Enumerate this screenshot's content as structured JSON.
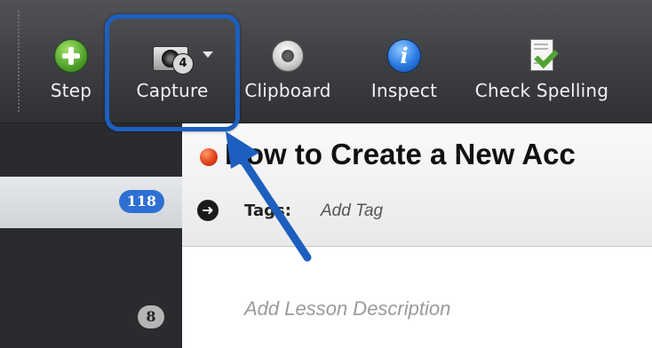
{
  "toolbar": {
    "tools": [
      {
        "label": "Step",
        "icon": "plus-icon"
      },
      {
        "label": "Capture",
        "icon": "camera-icon",
        "badge": "4"
      },
      {
        "label": "Clipboard",
        "icon": "clipboard-icon"
      },
      {
        "label": "Inspect",
        "icon": "info-icon"
      },
      {
        "label": "Check Spelling",
        "icon": "spellcheck-icon"
      }
    ]
  },
  "sidebar": {
    "counts": [
      "118",
      "8"
    ]
  },
  "lesson": {
    "title": "How to Create a New Acc",
    "tags_label": "Tags:",
    "tags_placeholder": "Add Tag",
    "description_placeholder": "Add Lesson Description"
  },
  "colors": {
    "highlight": "#1d5fbf",
    "badge_selected": "#2e6fd3",
    "status_dot": "#e2421a"
  }
}
